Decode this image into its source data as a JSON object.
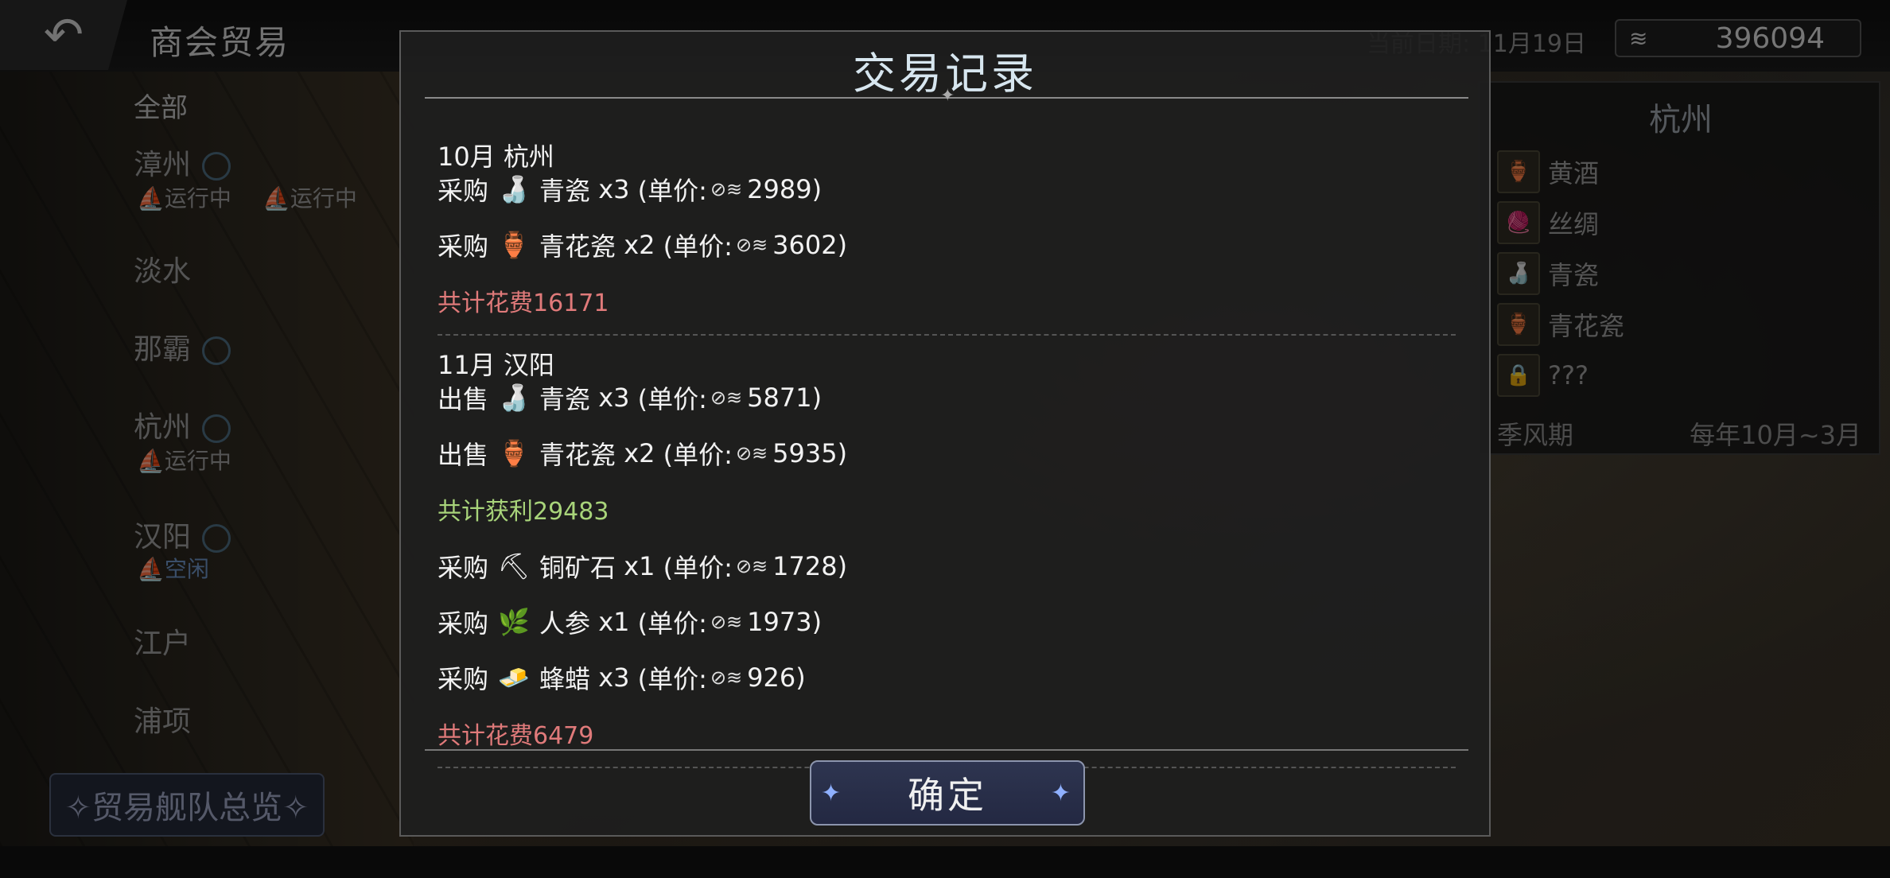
{
  "header": {
    "back_icon": "↶",
    "title": "商会贸易",
    "date_label": "当前日期: 11月19日",
    "coin_icon": "≋",
    "money": "396094"
  },
  "left_list": {
    "all_label": "全部",
    "cities": [
      {
        "name": "漳州",
        "has_emblem": true,
        "statuses": [
          "⛵运行中",
          "⛵运行中"
        ]
      },
      {
        "name": "淡水",
        "has_emblem": false,
        "statuses": []
      },
      {
        "name": "那霸",
        "has_emblem": true,
        "statuses": []
      },
      {
        "name": "杭州",
        "has_emblem": true,
        "statuses": [
          "⛵运行中"
        ]
      },
      {
        "name": "汉阳",
        "has_emblem": true,
        "statuses": [
          "⛵空闲"
        ]
      },
      {
        "name": "江户",
        "has_emblem": false,
        "statuses": []
      },
      {
        "name": "浦项",
        "has_emblem": false,
        "statuses": []
      }
    ],
    "fleet_overview_label": "✧贸易舰队总览✧"
  },
  "right_panel": {
    "title": "杭州",
    "items": [
      {
        "name": "黄酒",
        "icon": "🏺"
      },
      {
        "name": "丝绸",
        "icon": "🧶"
      },
      {
        "name": "青瓷",
        "icon": "🍶"
      },
      {
        "name": "青花瓷",
        "icon": "🏺"
      },
      {
        "name": "???",
        "icon": "🔒"
      }
    ],
    "season_label": "季风期",
    "season_value": "每年10月~3月"
  },
  "modal": {
    "title": "交易记录",
    "coin_icon": "⊘≋",
    "groups": [
      {
        "header": "10月  杭州",
        "lines": [
          {
            "action": "采购",
            "icon": "🍶",
            "item": "青瓷",
            "qty": "x3",
            "price_prefix": "(单价:",
            "price": "2989)"
          },
          {
            "action": "采购",
            "icon": "🏺",
            "item": "青花瓷",
            "qty": "x2",
            "price_prefix": "(单价:",
            "price": "3602)"
          }
        ],
        "total": "共计花费16171"
      },
      {
        "header": "11月  汉阳",
        "lines": [
          {
            "action": "出售",
            "icon": "🍶",
            "item": "青瓷",
            "qty": "x3",
            "price_prefix": "(单价:",
            "price": "5871)"
          },
          {
            "action": "出售",
            "icon": "🏺",
            "item": "青花瓷",
            "qty": "x2",
            "price_prefix": "(单价:",
            "price": "5935)"
          }
        ],
        "profit": "共计获利29483",
        "lines2": [
          {
            "action": "采购",
            "icon": "⛏",
            "item": "铜矿石",
            "qty": "x1",
            "price_prefix": "(单价:",
            "price": "1728)"
          },
          {
            "action": "采购",
            "icon": "🌿",
            "item": "人参",
            "qty": "x1",
            "price_prefix": "(单价:",
            "price": "1973)"
          },
          {
            "action": "采购",
            "icon": "🧈",
            "item": "蜂蜡",
            "qty": "x3",
            "price_prefix": "(单价:",
            "price": "926)"
          }
        ],
        "total2": "共计花费6479"
      }
    ],
    "confirm_label": "确定",
    "spark_icon": "✦"
  }
}
